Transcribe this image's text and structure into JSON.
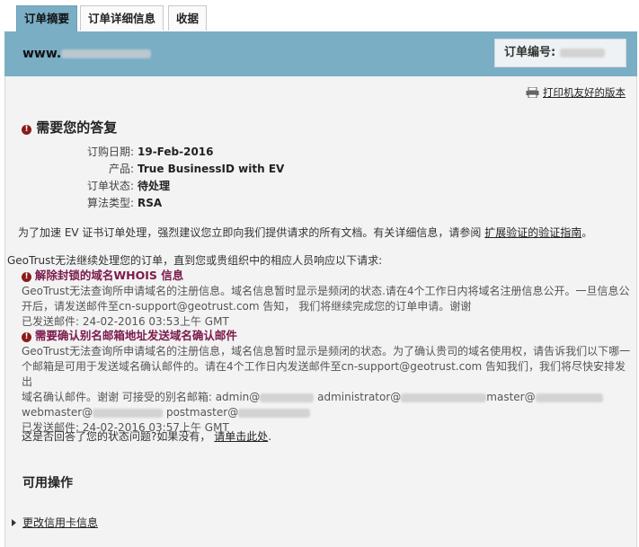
{
  "tabs": [
    "订单摘要",
    "订单详细信息",
    "收据"
  ],
  "header": {
    "site_prefix": "www.",
    "order_label": "订单编号:"
  },
  "print_link": "打印机友好的版本",
  "need_response": {
    "title": "需要您的答复",
    "fields": [
      {
        "label": "订购日期:",
        "value": "19-Feb-2016"
      },
      {
        "label": "产品:",
        "value": "True BusinessID with EV"
      },
      {
        "label": "订单状态:",
        "value": "待处理"
      },
      {
        "label": "算法类型:",
        "value": "RSA"
      }
    ],
    "advice_text": "为了加速 EV 证书订单处理，强烈建议您立即向我们提供请求的所有文档。有关详细信息，请参阅",
    "advice_link": "扩展验证的验证指南",
    "advice_end": "。"
  },
  "continue_text": "GeoTrust无法继续处理您的订单，直到您或贵组织中的相应人员响应以下请求:",
  "issues": [
    {
      "title": "解除封锁的域名WHOIS 信息",
      "line1": "GeoTrust无法查询所申请域名的注册信息。域名信息暂时显示是频闭的状态.请在4个工作日内将域名注册信息公开。一旦信息公",
      "line2": "开后，请发送邮件至cn-support@geotrust.com 告知， 我们将继续完成您的订单申请。谢谢",
      "sent": "已发送邮件:  24-02-2016  03:53上午  GMT"
    },
    {
      "title": "需要确认别名邮箱地址发送域名确认邮件",
      "line1": "GeoTrust无法查询所申请域名的注册信息，域名信息暂时显示是频闭的状态。为了确认贵司的域名使用权，请告诉我们以下哪一",
      "line2": "个邮箱是可用于发送域名确认邮件的。请在4个工作日内发送邮件至cn-support@geotrust.com 告知我们，我们将尽快安排发出",
      "line3": "域名确认邮件。谢谢  可接受的别名邮箱:",
      "emails_a": [
        "admin@",
        "administrator@",
        "master@"
      ],
      "emails_b": [
        "webmaster@",
        "postmaster@"
      ],
      "sent": "已发送邮件:  24-02-2016  03:57上午  GMT"
    }
  ],
  "question_text": "这是否回答了您的状态问题?如果没有，",
  "question_link": "请单击此处",
  "question_end": ".",
  "actions_title": "可用操作",
  "actions": [
    "更改信用卡信息"
  ],
  "colors": {
    "header_bg": "#7aaec5",
    "issue_title": "#7b1a4b",
    "content_bg": "#f3f3f3"
  }
}
